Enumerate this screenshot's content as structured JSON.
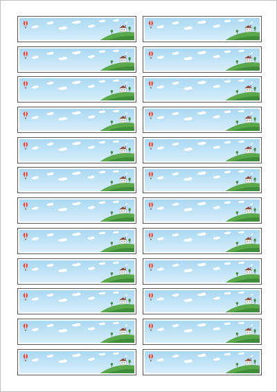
{
  "sheet": {
    "columns": 2,
    "rows": 12,
    "label_count": 24
  },
  "label_design": {
    "icons": [
      "hot-air-balloon-icon",
      "cloud-icon",
      "hill-icon",
      "house-icon",
      "tree-icon"
    ],
    "colors": {
      "sky_top": "#a9d8f2",
      "sky_bottom": "#d8eefa",
      "cloud": "#ffffff",
      "balloon": "#e0473f",
      "balloon_stripe": "#ffffff",
      "hill": "#5aa84a",
      "hill_dark": "#3f8d3a",
      "house_wall": "#f4efe4",
      "house_roof": "#8a4b3c",
      "border": "#555555"
    }
  }
}
